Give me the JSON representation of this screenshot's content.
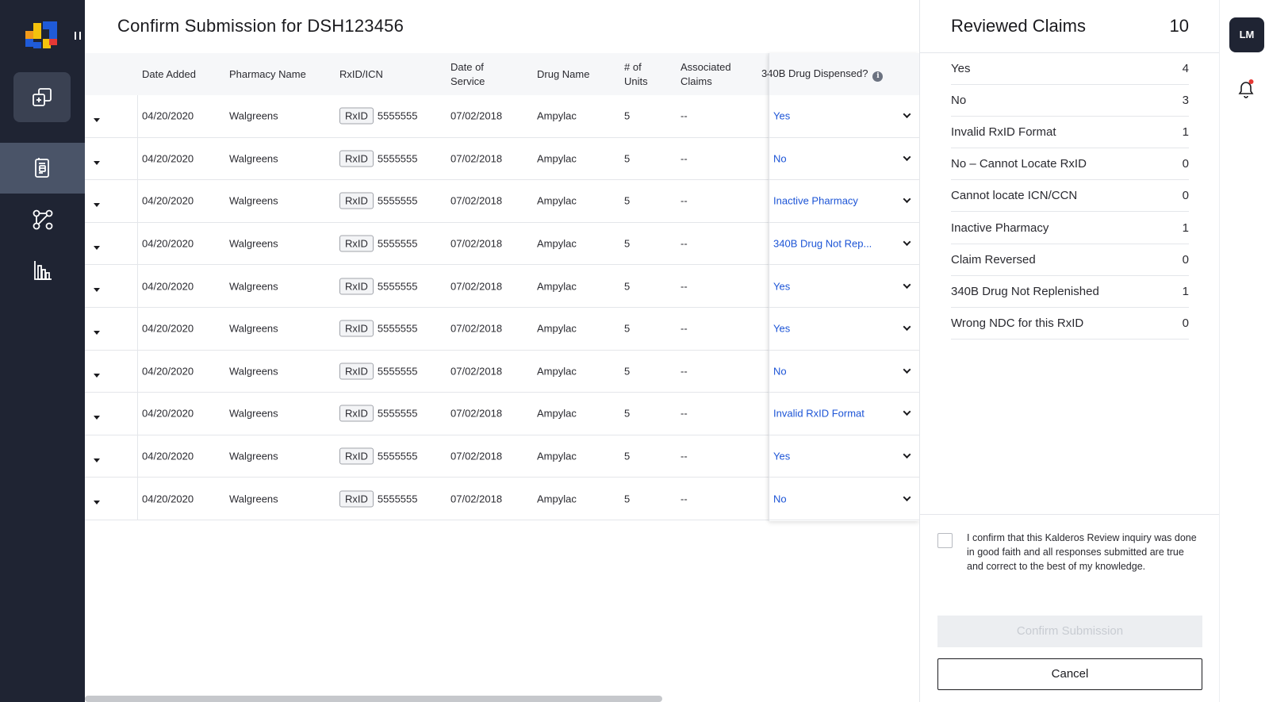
{
  "colors": {
    "nav_bg": "#1f2433",
    "nav_selected": "#4a5468",
    "link_blue": "#1c54d6",
    "logo_blue": "#1f5bd8",
    "logo_orange": "#f29a1a",
    "logo_yellow": "#f4c20d",
    "notification_dot": "#e53935"
  },
  "nav": {
    "items": [
      {
        "icon": "copy-icon",
        "selected": false
      },
      {
        "icon": "document-icon",
        "selected": true
      },
      {
        "icon": "network-icon",
        "selected": false
      },
      {
        "icon": "bar-chart-icon",
        "selected": false
      }
    ]
  },
  "main": {
    "title": "Confirm Submission for DSH123456",
    "columns": {
      "date_added": "Date Added",
      "pharmacy": "Pharmacy Name",
      "rxid": "RxID/ICN",
      "dos_line1": "Date of",
      "dos_line2": "Service",
      "drug": "Drug Name",
      "units_line1": "# of",
      "units_line2": "Units",
      "assoc_line1": "Associated",
      "assoc_line2": "Claims",
      "dispensed": "340B Drug Dispensed?"
    },
    "rows": [
      {
        "date_added": "04/20/2020",
        "pharmacy": "Walgreens",
        "rx_tag": "RxID",
        "rx_number": "5555555",
        "date_of_service": "07/02/2018",
        "drug": "Ampylac",
        "units": "5",
        "associated": "--",
        "response": "Yes"
      },
      {
        "date_added": "04/20/2020",
        "pharmacy": "Walgreens",
        "rx_tag": "RxID",
        "rx_number": "5555555",
        "date_of_service": "07/02/2018",
        "drug": "Ampylac",
        "units": "5",
        "associated": "--",
        "response": "No"
      },
      {
        "date_added": "04/20/2020",
        "pharmacy": "Walgreens",
        "rx_tag": "RxID",
        "rx_number": "5555555",
        "date_of_service": "07/02/2018",
        "drug": "Ampylac",
        "units": "5",
        "associated": "--",
        "response": "Inactive Pharmacy"
      },
      {
        "date_added": "04/20/2020",
        "pharmacy": "Walgreens",
        "rx_tag": "RxID",
        "rx_number": "5555555",
        "date_of_service": "07/02/2018",
        "drug": "Ampylac",
        "units": "5",
        "associated": "--",
        "response": "340B Drug Not Rep..."
      },
      {
        "date_added": "04/20/2020",
        "pharmacy": "Walgreens",
        "rx_tag": "RxID",
        "rx_number": "5555555",
        "date_of_service": "07/02/2018",
        "drug": "Ampylac",
        "units": "5",
        "associated": "--",
        "response": "Yes"
      },
      {
        "date_added": "04/20/2020",
        "pharmacy": "Walgreens",
        "rx_tag": "RxID",
        "rx_number": "5555555",
        "date_of_service": "07/02/2018",
        "drug": "Ampylac",
        "units": "5",
        "associated": "--",
        "response": "Yes"
      },
      {
        "date_added": "04/20/2020",
        "pharmacy": "Walgreens",
        "rx_tag": "RxID",
        "rx_number": "5555555",
        "date_of_service": "07/02/2018",
        "drug": "Ampylac",
        "units": "5",
        "associated": "--",
        "response": "No"
      },
      {
        "date_added": "04/20/2020",
        "pharmacy": "Walgreens",
        "rx_tag": "RxID",
        "rx_number": "5555555",
        "date_of_service": "07/02/2018",
        "drug": "Ampylac",
        "units": "5",
        "associated": "--",
        "response": "Invalid RxID Format"
      },
      {
        "date_added": "04/20/2020",
        "pharmacy": "Walgreens",
        "rx_tag": "RxID",
        "rx_number": "5555555",
        "date_of_service": "07/02/2018",
        "drug": "Ampylac",
        "units": "5",
        "associated": "--",
        "response": "Yes"
      },
      {
        "date_added": "04/20/2020",
        "pharmacy": "Walgreens",
        "rx_tag": "RxID",
        "rx_number": "5555555",
        "date_of_service": "07/02/2018",
        "drug": "Ampylac",
        "units": "5",
        "associated": "--",
        "response": "No"
      }
    ]
  },
  "panel": {
    "title": "Reviewed Claims",
    "total": "10",
    "summary": [
      {
        "label": "Yes",
        "count": "4"
      },
      {
        "label": "No",
        "count": "3"
      },
      {
        "label": "Invalid RxID Format",
        "count": "1"
      },
      {
        "label": "No – Cannot Locate RxID",
        "count": "0"
      },
      {
        "label": "Cannot locate ICN/CCN",
        "count": "0"
      },
      {
        "label": "Inactive Pharmacy",
        "count": "1"
      },
      {
        "label": "Claim Reversed",
        "count": "0"
      },
      {
        "label": "340B Drug Not Replenished",
        "count": "1"
      },
      {
        "label": "Wrong NDC for this RxID",
        "count": "0"
      }
    ],
    "confirmation_text": "I confirm that this Kalderos Review inquiry was done in good faith and all responses submitted are true and correct to the best of my knowledge.",
    "confirm_button": "Confirm Submission",
    "cancel_button": "Cancel"
  },
  "rail": {
    "avatar_initials": "LM",
    "bell_icon": "bell-icon"
  }
}
